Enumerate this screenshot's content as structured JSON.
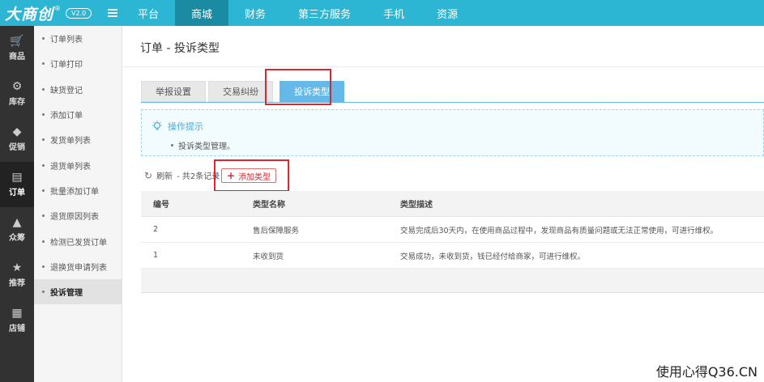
{
  "header": {
    "logo_text": "大商创",
    "logo_reg": "®",
    "version": "V2.0",
    "nav": [
      "平台",
      "商城",
      "财务",
      "第三方服务",
      "手机",
      "资源"
    ],
    "active_nav": "商城"
  },
  "sidebar_icons": [
    {
      "label": "商品",
      "icon": "cart-icon"
    },
    {
      "label": "库存",
      "icon": "gears-icon"
    },
    {
      "label": "促销",
      "icon": "tag-icon"
    },
    {
      "label": "订单",
      "icon": "clipboard-icon"
    },
    {
      "label": "众筹",
      "icon": "mountain-icon"
    },
    {
      "label": "推荐",
      "icon": "star-icon"
    },
    {
      "label": "店铺",
      "icon": "store-icon"
    }
  ],
  "sidebar_menu": [
    "订单列表",
    "订单打印",
    "缺货登记",
    "添加订单",
    "发货单列表",
    "退货单列表",
    "批量添加订单",
    "退货原因列表",
    "检测已发货订单",
    "退换货申请列表",
    "投诉管理"
  ],
  "page": {
    "title": "订单 - 投诉类型",
    "tabs": [
      "举报设置",
      "交易纠纷",
      "投诉类型"
    ],
    "active_tab": "投诉类型",
    "tip_title": "操作提示",
    "tip_item": "投诉类型管理。",
    "refresh_label": "刷新",
    "record_count": "- 共2条记录",
    "add_button": "添加类型"
  },
  "table": {
    "columns": [
      "编号",
      "类型名称",
      "类型描述"
    ],
    "rows": [
      [
        "2",
        "售后保障服务",
        "交易完成后30天内，在使用商品过程中，发现商品有质量问题或无法正常使用，可进行维权。"
      ],
      [
        "1",
        "未收到货",
        "交易成功，未收到货，钱已经付给商家，可进行维权。"
      ]
    ]
  },
  "watermark": "使用心得Q36.CN",
  "colors": {
    "topbar": "#2cb6d3",
    "nav_active": "#1a8ba3",
    "tab_active": "#65b9e8",
    "highlight": "#d9282f"
  }
}
